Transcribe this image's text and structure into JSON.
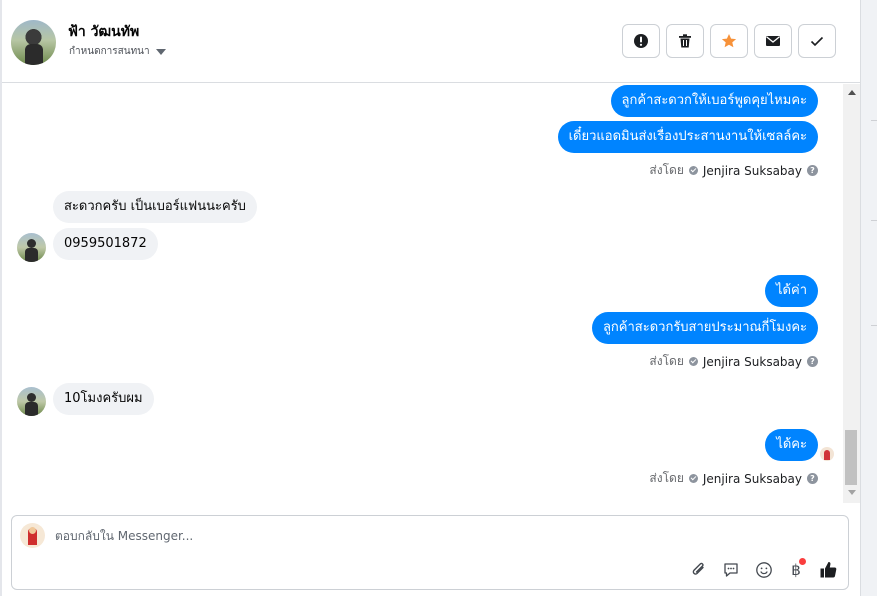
{
  "header": {
    "contact_name": "ฟ้า วัฒนทัพ",
    "assign_label": "กำหนดการสนทนา",
    "actions": [
      {
        "name": "report-spam",
        "icon": "exclamation-icon"
      },
      {
        "name": "delete",
        "icon": "trash-icon"
      },
      {
        "name": "star",
        "icon": "star-icon",
        "color": "#f7923a"
      },
      {
        "name": "mark-unread",
        "icon": "envelope-icon"
      },
      {
        "name": "mark-done",
        "icon": "checkmark-icon"
      }
    ]
  },
  "messages": [
    {
      "from": "page",
      "text": "ลูกค้าสะดวกให้เบอร์พูดคุยไหมคะ"
    },
    {
      "from": "page",
      "text": "เดี๋ยวแอดมินส่งเรื่องประสานงานให้เซลล์คะ"
    },
    {
      "from": "page-meta",
      "sent_by_label": "ส่งโดย",
      "agent": "Jenjira Suksabay"
    },
    {
      "from": "customer",
      "text": "สะดวกครับ เป็นเบอร์แฟนนะครับ"
    },
    {
      "from": "customer",
      "text": "0959501872"
    },
    {
      "from": "page",
      "text": "ได้ค่า"
    },
    {
      "from": "page",
      "text": "ลูกค้าสะดวกรับสายประมาณกี่โมงคะ"
    },
    {
      "from": "page-meta",
      "sent_by_label": "ส่งโดย",
      "agent": "Jenjira Suksabay"
    },
    {
      "from": "customer",
      "text": "10โมงครับผม"
    },
    {
      "from": "page",
      "text": "ได้คะ"
    },
    {
      "from": "page-meta",
      "sent_by_label": "ส่งโดย",
      "agent": "Jenjira Suksabay"
    }
  ],
  "composer": {
    "placeholder": "ตอบกลับใน Messenger...",
    "tools": [
      "paperclip-icon",
      "saved-reply-icon",
      "emoji-icon",
      "baht-payment-icon",
      "thumbs-up-icon"
    ],
    "baht_symbol": "฿",
    "accent": "#0084ff"
  },
  "colors": {
    "outgoing_bubble": "#0084ff",
    "incoming_bubble": "#f0f2f5",
    "star": "#f7923a"
  }
}
